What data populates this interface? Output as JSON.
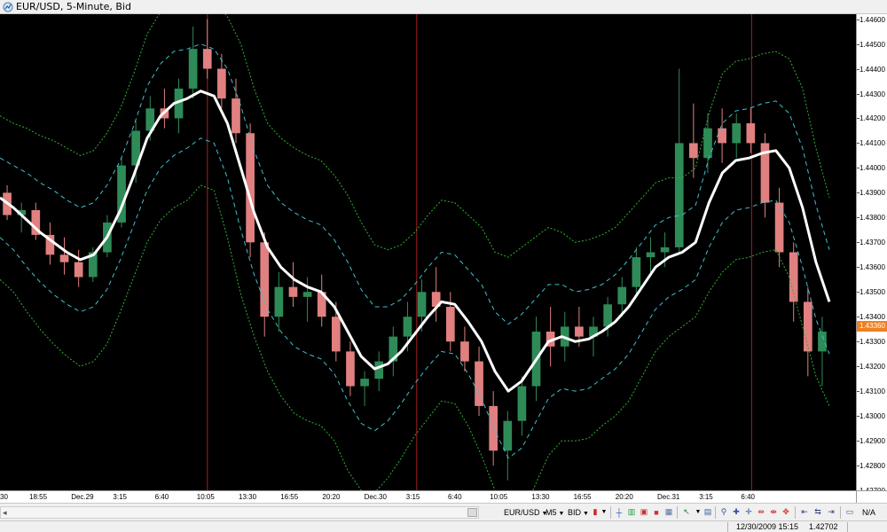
{
  "window": {
    "title": "EUR/USD, 5-Minute, Bid"
  },
  "chart": {
    "background": "#000000",
    "price_axis_labels": [
      "1.44600",
      "1.44500",
      "1.44400",
      "1.44300",
      "1.44200",
      "1.44100",
      "1.44000",
      "1.43900",
      "1.43800",
      "1.43700",
      "1.43600",
      "1.43500",
      "1.43400",
      "1.43300",
      "1.43200",
      "1.43100",
      "1.43000",
      "1.42900",
      "1.42800",
      "1.42700"
    ],
    "current_price": "1.43360",
    "current_price_color": "#f08020",
    "time_axis_labels": [
      "30",
      "18:55",
      "Dec.29",
      "3:15",
      "6:40",
      "10:05",
      "13:30",
      "16:55",
      "20:20",
      "Dec.30",
      "3:15",
      "6:40",
      "10:05",
      "13:30",
      "16:55",
      "20:20",
      "Dec.31",
      "3:15",
      "6:40"
    ],
    "colors": {
      "up_candle": "#2e8b57",
      "down_candle": "#e08080",
      "ma_line": "#ffffff",
      "inner_band": "#40c0d0",
      "outer_band": "#30b030",
      "day_separator": "#8b1a1a"
    }
  },
  "chart_data": {
    "type": "line",
    "title": "EUR/USD, 5-Minute, Bid",
    "xlabel": "",
    "ylabel": "",
    "ylim": [
      1.427,
      1.4462
    ],
    "x_ticks": [
      "30",
      "18:55",
      "Dec.29",
      "3:15",
      "6:40",
      "10:05",
      "13:30",
      "16:55",
      "20:20",
      "Dec.30",
      "3:15",
      "6:40",
      "10:05",
      "13:30",
      "16:55",
      "20:20",
      "Dec.31",
      "3:15",
      "6:40"
    ],
    "day_separators": [
      "Dec.29 10:05",
      "Dec.30 3:15",
      "Dec.31 6:40"
    ],
    "series": [
      {
        "values": [
          1.4388,
          1.4384,
          1.4379,
          1.4374,
          1.437,
          1.4366,
          1.4363,
          1.4365,
          1.4372,
          1.4383,
          1.4397,
          1.4412,
          1.4421,
          1.4426,
          1.4428,
          1.4431,
          1.4429,
          1.4418,
          1.44,
          1.4382,
          1.4368,
          1.436,
          1.4355,
          1.4352,
          1.435,
          1.4344,
          1.4334,
          1.4324,
          1.4319,
          1.4321,
          1.4326,
          1.4333,
          1.434,
          1.4346,
          1.4345,
          1.4338,
          1.433,
          1.4318,
          1.431,
          1.4314,
          1.4322,
          1.433,
          1.4332,
          1.433,
          1.4331,
          1.4334,
          1.4338,
          1.4344,
          1.4352,
          1.436,
          1.4364,
          1.4366,
          1.437,
          1.4386,
          1.4398,
          1.4403,
          1.4404,
          1.4406,
          1.4407,
          1.44,
          1.4384,
          1.4362,
          1.4346
        ]
      },
      {
        "values": [
          1.4372,
          1.4367,
          1.436,
          1.4354,
          1.4349,
          1.4345,
          1.4342,
          1.4344,
          1.4351,
          1.4363,
          1.4377,
          1.4391,
          1.44,
          1.4405,
          1.4408,
          1.4412,
          1.441,
          1.4396,
          1.4375,
          1.4357,
          1.4343,
          1.4334,
          1.4328,
          1.4325,
          1.4323,
          1.4317,
          1.4306,
          1.4297,
          1.4294,
          1.4298,
          1.4305,
          1.4313,
          1.432,
          1.4326,
          1.4325,
          1.4317,
          1.4307,
          1.4294,
          1.4283,
          1.4287,
          1.4297,
          1.4307,
          1.4311,
          1.431,
          1.4311,
          1.4315,
          1.4319,
          1.4325,
          1.4334,
          1.4343,
          1.4348,
          1.4351,
          1.4355,
          1.4368,
          1.4378,
          1.4383,
          1.4384,
          1.4386,
          1.4387,
          1.4378,
          1.436,
          1.4339,
          1.4325
        ]
      },
      {
        "values": [
          1.4404,
          1.4401,
          1.4398,
          1.4394,
          1.4391,
          1.4387,
          1.4384,
          1.4386,
          1.4393,
          1.4403,
          1.4417,
          1.4433,
          1.4442,
          1.4447,
          1.4448,
          1.445,
          1.4448,
          1.444,
          1.4425,
          1.4407,
          1.4393,
          1.4386,
          1.4382,
          1.4379,
          1.4377,
          1.4371,
          1.4362,
          1.4351,
          1.4344,
          1.4344,
          1.4347,
          1.4353,
          1.436,
          1.4366,
          1.4365,
          1.4359,
          1.4353,
          1.4342,
          1.4337,
          1.4341,
          1.4347,
          1.4353,
          1.4353,
          1.435,
          1.4351,
          1.4353,
          1.4357,
          1.4363,
          1.437,
          1.4377,
          1.438,
          1.4381,
          1.4385,
          1.4404,
          1.4418,
          1.4423,
          1.4424,
          1.4426,
          1.4427,
          1.4422,
          1.4408,
          1.4385,
          1.4367
        ]
      },
      {
        "values": [
          1.4355,
          1.435,
          1.4342,
          1.4335,
          1.4329,
          1.4324,
          1.432,
          1.4322,
          1.4329,
          1.4342,
          1.4356,
          1.437,
          1.4379,
          1.4384,
          1.4387,
          1.4393,
          1.4391,
          1.4372,
          1.4349,
          1.4332,
          1.4318,
          1.4308,
          1.4301,
          1.4298,
          1.4296,
          1.429,
          1.4278,
          1.427,
          1.4269,
          1.4275,
          1.4283,
          1.4292,
          1.4299,
          1.4306,
          1.4305,
          1.4296,
          1.4284,
          1.427,
          1.4256,
          1.426,
          1.4272,
          1.4284,
          1.429,
          1.429,
          1.4291,
          1.4296,
          1.43,
          1.4306,
          1.4316,
          1.4326,
          1.4332,
          1.4336,
          1.434,
          1.435,
          1.4358,
          1.4363,
          1.4364,
          1.4366,
          1.4367,
          1.4356,
          1.4336,
          1.4316,
          1.4304
        ]
      },
      {
        "values": [
          1.4421,
          1.4418,
          1.4416,
          1.4413,
          1.4411,
          1.4408,
          1.4405,
          1.4407,
          1.4414,
          1.4424,
          1.4438,
          1.4454,
          1.4463,
          1.4468,
          1.4469,
          1.447,
          1.4468,
          1.4461,
          1.445,
          1.4432,
          1.4418,
          1.4412,
          1.4408,
          1.4405,
          1.4403,
          1.4397,
          1.4389,
          1.4378,
          1.4369,
          1.4367,
          1.4369,
          1.4374,
          1.4381,
          1.4387,
          1.4386,
          1.4381,
          1.4376,
          1.4366,
          1.4364,
          1.4368,
          1.4372,
          1.4376,
          1.4374,
          1.437,
          1.4371,
          1.4373,
          1.4376,
          1.4382,
          1.4388,
          1.4394,
          1.4396,
          1.4396,
          1.44,
          1.4422,
          1.4438,
          1.4443,
          1.4444,
          1.4446,
          1.4447,
          1.4444,
          1.4432,
          1.4408,
          1.4388
        ]
      }
    ],
    "candles": [
      [
        1.439,
        1.4393,
        1.4379,
        1.4381
      ],
      [
        1.4381,
        1.4386,
        1.4374,
        1.4383
      ],
      [
        1.4383,
        1.4386,
        1.4371,
        1.4373
      ],
      [
        1.4373,
        1.4378,
        1.4361,
        1.4365
      ],
      [
        1.4365,
        1.4372,
        1.4357,
        1.4362
      ],
      [
        1.4362,
        1.4367,
        1.4352,
        1.4356
      ],
      [
        1.4356,
        1.4368,
        1.4354,
        1.4366
      ],
      [
        1.4366,
        1.4381,
        1.4364,
        1.4378
      ],
      [
        1.4378,
        1.4404,
        1.4376,
        1.4401
      ],
      [
        1.4401,
        1.4419,
        1.4394,
        1.4415
      ],
      [
        1.4415,
        1.4429,
        1.4411,
        1.4424
      ],
      [
        1.4424,
        1.4432,
        1.4416,
        1.442
      ],
      [
        1.442,
        1.4436,
        1.4414,
        1.4432
      ],
      [
        1.4432,
        1.4457,
        1.4428,
        1.4448
      ],
      [
        1.4448,
        1.446,
        1.4436,
        1.444
      ],
      [
        1.444,
        1.4446,
        1.4424,
        1.4428
      ],
      [
        1.4428,
        1.4436,
        1.441,
        1.4414
      ],
      [
        1.4414,
        1.4418,
        1.4364,
        1.437
      ],
      [
        1.437,
        1.4374,
        1.4332,
        1.434
      ],
      [
        1.434,
        1.4358,
        1.4334,
        1.4352
      ],
      [
        1.4352,
        1.4362,
        1.4344,
        1.4348
      ],
      [
        1.4348,
        1.4356,
        1.4338,
        1.435
      ],
      [
        1.435,
        1.4357,
        1.4336,
        1.434
      ],
      [
        1.434,
        1.4346,
        1.4322,
        1.4326
      ],
      [
        1.4326,
        1.433,
        1.4308,
        1.4312
      ],
      [
        1.4312,
        1.4318,
        1.4304,
        1.4315
      ],
      [
        1.4315,
        1.4326,
        1.431,
        1.4322
      ],
      [
        1.4322,
        1.4336,
        1.4316,
        1.4332
      ],
      [
        1.4332,
        1.4346,
        1.4326,
        1.434
      ],
      [
        1.434,
        1.4355,
        1.4334,
        1.435
      ],
      [
        1.435,
        1.436,
        1.4338,
        1.4344
      ],
      [
        1.4344,
        1.435,
        1.4326,
        1.433
      ],
      [
        1.433,
        1.4336,
        1.4318,
        1.4322
      ],
      [
        1.4322,
        1.4328,
        1.43,
        1.4304
      ],
      [
        1.4304,
        1.431,
        1.428,
        1.4286
      ],
      [
        1.4286,
        1.4302,
        1.4274,
        1.4298
      ],
      [
        1.4298,
        1.4316,
        1.4292,
        1.4312
      ],
      [
        1.4312,
        1.434,
        1.4306,
        1.4334
      ],
      [
        1.4334,
        1.4344,
        1.432,
        1.4328
      ],
      [
        1.4328,
        1.4342,
        1.4322,
        1.4336
      ],
      [
        1.4336,
        1.4344,
        1.4328,
        1.4332
      ],
      [
        1.4332,
        1.434,
        1.4324,
        1.4336
      ],
      [
        1.4336,
        1.4348,
        1.4332,
        1.4345
      ],
      [
        1.4345,
        1.4356,
        1.434,
        1.4352
      ],
      [
        1.4352,
        1.4368,
        1.4348,
        1.4364
      ],
      [
        1.4364,
        1.4372,
        1.4356,
        1.4366
      ],
      [
        1.4366,
        1.4374,
        1.436,
        1.4368
      ],
      [
        1.4368,
        1.444,
        1.4366,
        1.441
      ],
      [
        1.441,
        1.4426,
        1.4396,
        1.4404
      ],
      [
        1.4404,
        1.4422,
        1.4398,
        1.4416
      ],
      [
        1.4416,
        1.4424,
        1.4402,
        1.441
      ],
      [
        1.441,
        1.4422,
        1.4404,
        1.4418
      ],
      [
        1.4418,
        1.4424,
        1.4406,
        1.441
      ],
      [
        1.441,
        1.4414,
        1.438,
        1.4386
      ],
      [
        1.4386,
        1.4392,
        1.436,
        1.4366
      ],
      [
        1.4366,
        1.437,
        1.4338,
        1.4346
      ],
      [
        1.4346,
        1.4352,
        1.4316,
        1.4326
      ],
      [
        1.4326,
        1.434,
        1.4312,
        1.4334
      ]
    ]
  },
  "toolbar": {
    "symbol": "EUR/USD",
    "timeframe": "M5",
    "price_type": "BID",
    "right_value": "N/A"
  },
  "statusbar": {
    "datetime": "12/30/2009 15:15",
    "price": "1.42702"
  }
}
